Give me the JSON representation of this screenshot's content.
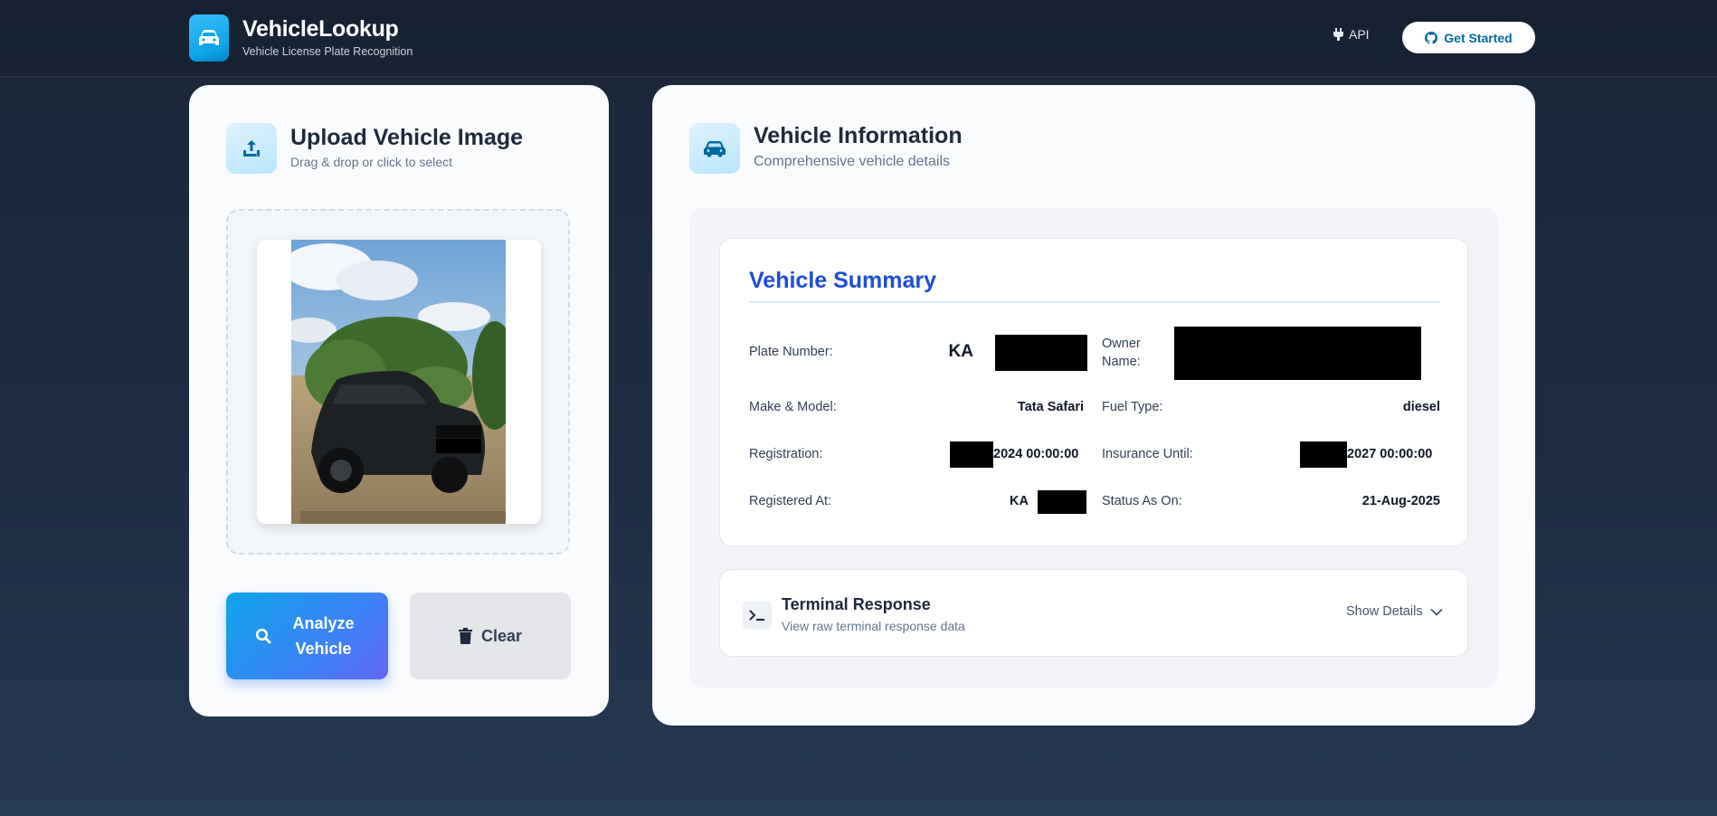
{
  "header": {
    "brand_title": "VehicleLookup",
    "brand_subtitle": "Vehicle License Plate Recognition",
    "api_label": "API",
    "get_started_label": "Get Started",
    "logo_icon": "car-icon"
  },
  "upload": {
    "title": "Upload Vehicle Image",
    "subtitle": "Drag & drop or click to select",
    "icon": "upload-icon",
    "analyze_label": "Analyze Vehicle",
    "clear_label": "Clear"
  },
  "info": {
    "title": "Vehicle Information",
    "subtitle": "Comprehensive vehicle details",
    "icon": "car-icon"
  },
  "summary": {
    "title": "Vehicle Summary",
    "fields": [
      {
        "label": "Plate Number:",
        "value": "KA"
      },
      {
        "label": "Owner Name:",
        "value": ""
      },
      {
        "label": "Make & Model:",
        "value": "Tata Safari"
      },
      {
        "label": "Fuel Type:",
        "value": "diesel"
      },
      {
        "label": "Registration:",
        "value": "2024 00:00:00"
      },
      {
        "label": "Insurance Until:",
        "value": "2027 00:00:00"
      },
      {
        "label": "Registered At:",
        "value": "KA"
      },
      {
        "label": "Status As On:",
        "value": "21-Aug-2025"
      }
    ]
  },
  "terminal": {
    "title": "Terminal Response",
    "subtitle": "View raw terminal response data",
    "toggle_label": "Show Details",
    "icon": "terminal-icon"
  },
  "colors": {
    "accent": "#1d4ed8",
    "brand": "#0ea5e9",
    "background": "#1e2d44"
  }
}
